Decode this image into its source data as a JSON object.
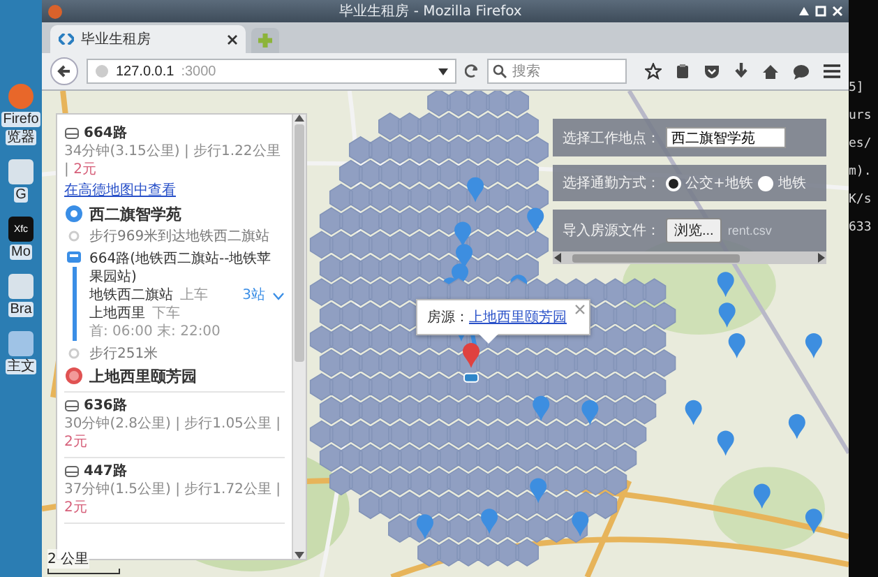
{
  "desktop_icons": [
    {
      "kind": "browser",
      "label": [
        "Firefo",
        "览器"
      ]
    },
    {
      "kind": "app",
      "label": [
        "G"
      ]
    },
    {
      "kind": "terminal",
      "icon_text": "Xfc",
      "label": [
        "Mo"
      ]
    },
    {
      "kind": "app",
      "label": [
        "Bra"
      ]
    },
    {
      "kind": "folder",
      "label": [
        "主文"
      ]
    }
  ],
  "window": {
    "title": "毕业生租房 - Mozilla Firefox"
  },
  "tabs": [
    {
      "label": "毕业生租房",
      "selected": true
    }
  ],
  "address_bar": {
    "host": "127.0.0.1",
    "port": ":3000"
  },
  "search": {
    "placeholder": "搜索"
  },
  "route_panel": {
    "routes": [
      {
        "name": "664路",
        "summary": [
          {
            "kind": "plain",
            "text": "34分钟(3.15公里) | 步行1.22公里 | "
          },
          {
            "kind": "price",
            "text": "2元"
          }
        ],
        "link": "在高德地图中查看",
        "steps": [
          {
            "kind": "start",
            "text": "西二旗智学苑"
          },
          {
            "kind": "walk",
            "text": "步行969米到达地铁西二旗站"
          },
          {
            "kind": "bus",
            "text": "664路(地铁西二旗站--地铁苹果园站)",
            "board": {
              "station": "地铁西二旗站",
              "action": "上车",
              "stops": "3站",
              "expanded": false
            },
            "alight": {
              "station": "上地西里",
              "action": "下车"
            },
            "hours": "首: 06:00 末: 22:00"
          },
          {
            "kind": "walk",
            "text": "步行251米"
          },
          {
            "kind": "end",
            "text": "上地西里颐芳园"
          }
        ]
      },
      {
        "name": "636路",
        "summary": [
          {
            "kind": "plain",
            "text": "30分钟(2.8公里) | 步行1.05公里 | "
          },
          {
            "kind": "price",
            "text": "2元"
          }
        ]
      },
      {
        "name": "447路",
        "summary": [
          {
            "kind": "plain",
            "text": "37分钟(1.5公里) | 步行1.72公里 | "
          },
          {
            "kind": "price",
            "text": "2元"
          }
        ]
      }
    ]
  },
  "controls": {
    "work_place": {
      "label": "选择工作地点：",
      "value": "西二旗智学苑"
    },
    "commute": {
      "label": "选择通勤方式：",
      "options": [
        {
          "label": "公交+地铁",
          "selected": true
        },
        {
          "label": "地铁",
          "selected": false
        }
      ]
    },
    "import": {
      "label": "导入房源文件：",
      "button": "浏览...",
      "file": "rent.csv"
    }
  },
  "popup": {
    "label": "房源：",
    "link": "上地西里颐芳园"
  },
  "scale": {
    "label": "2 公里"
  },
  "terminal": {
    "lines": [
      "5]",
      "urs",
      "es/",
      "m).",
      "K/s",
      "633"
    ]
  }
}
